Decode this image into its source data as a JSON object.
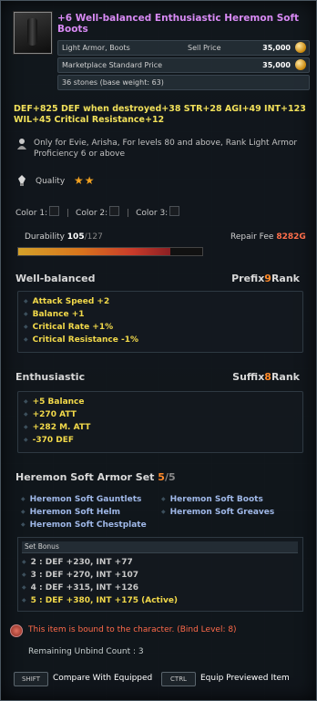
{
  "item": {
    "name": "+6 Well-balanced Enthusiastic Heremon Soft Boots",
    "type": "Light Armor, Boots",
    "sell_price_label": "Sell Price",
    "sell_price": "35,000",
    "market_price_label": "Marketplace Standard Price",
    "market_price": "35,000",
    "weight": "36 stones (base weight: 63)"
  },
  "stats": {
    "line1": "DEF+825  DEF when destroyed+38  STR+28  AGI+49  INT+123",
    "line2": "WIL+45  Critical Resistance+12"
  },
  "requirement": "Only for Evie, Arisha, For levels 80 and above, Rank Light Armor Proficiency 6 or above",
  "quality": {
    "label": "Quality",
    "stars": "★★"
  },
  "colors": {
    "c1": "Color 1:",
    "c2": "Color 2:",
    "c3": "Color 3:"
  },
  "durability": {
    "label": "Durability",
    "current": "105",
    "max": "/127",
    "fill": 0.827
  },
  "repair": {
    "label": "Repair Fee",
    "value": "8282G"
  },
  "prefix": {
    "name": "Well-balanced",
    "rank_label": "Prefix",
    "rank": "9",
    "rank_suffix": "Rank",
    "effects": [
      "Attack Speed +2",
      "Balance +1",
      "Critical Rate +1%",
      "Critical Resistance -1%"
    ]
  },
  "suffix": {
    "name": "Enthusiastic",
    "rank_label": "Suffix",
    "rank": "8",
    "rank_suffix": "Rank",
    "effects": [
      "+5 Balance",
      "+270 ATT",
      "+282 M. ATT",
      "-370 DEF"
    ]
  },
  "set": {
    "title": "Heremon Soft Armor Set",
    "count": "5",
    "total": "/5",
    "items": [
      "Heremon Soft Gauntlets",
      "Heremon Soft Boots",
      "Heremon Soft Helm",
      "Heremon Soft Greaves",
      "Heremon Soft Chestplate"
    ],
    "bonus_header": "Set Bonus",
    "bonuses": [
      "2 : DEF +230, INT +77",
      "3 : DEF +270, INT +107",
      "4 : DEF +315, INT +126",
      "5 : DEF +380, INT +175 (Active)"
    ]
  },
  "binding": {
    "bound_text": "This item is bound to the character. (Bind Level: 8)",
    "unbind_text": "Remaining Unbind Count : 3"
  },
  "footer": {
    "shift_key": "SHIFT",
    "shift_desc": "Compare With Equipped",
    "ctrl_key": "CTRL",
    "ctrl_desc": "Equip Previewed Item"
  },
  "colors_theme": {
    "title": "#d88af4",
    "stat": "#f1e05a",
    "rank_num": "#ff8a2a",
    "set_item": "#9fb8e8",
    "bound": "#ff6a4a"
  }
}
